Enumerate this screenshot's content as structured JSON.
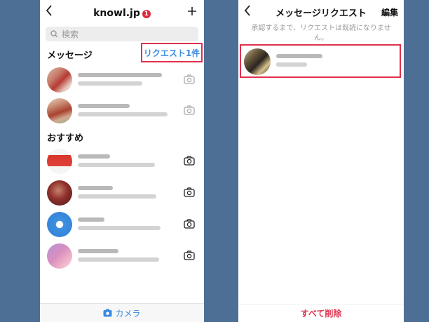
{
  "left": {
    "account_name": "knowl.jp",
    "badge_count": "1",
    "search_placeholder": "検索",
    "messages_title": "メッセージ",
    "request_link": "リクエスト1件",
    "suggestions_title": "おすすめ",
    "camera_label": "カメラ",
    "colors": {
      "accent": "#3a8ae0",
      "highlight": "#e0314e",
      "badge": "#e0263a"
    }
  },
  "right": {
    "title": "メッセージリクエスト",
    "edit_label": "編集",
    "note": "承認するまで、リクエストは既読になりません。",
    "delete_all": "すべて削除"
  },
  "icons": {
    "back": "chevron-left-icon",
    "new": "plus-icon",
    "search": "search-icon",
    "camera": "camera-icon"
  }
}
